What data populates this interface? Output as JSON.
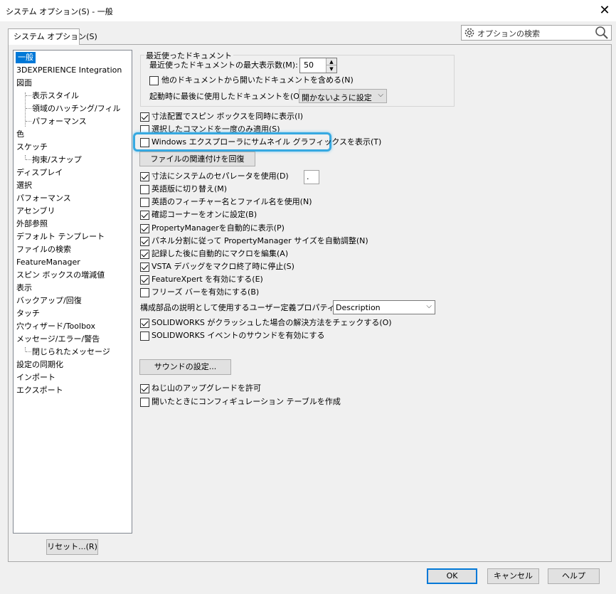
{
  "window": {
    "title": "システム オプション(S) - 一般",
    "close_glyph": "✕"
  },
  "tab": {
    "label": "システム オプション(S)"
  },
  "search": {
    "placeholder": "オプションの検索",
    "icon": "gear-icon",
    "search_icon": "magnifier-icon"
  },
  "tree": {
    "items": [
      {
        "label": "一般",
        "level": 0,
        "selected": true
      },
      {
        "label": "3DEXPERIENCE Integration",
        "level": 0
      },
      {
        "label": "図面",
        "level": 0
      },
      {
        "label": "表示スタイル",
        "level": 1
      },
      {
        "label": "領域のハッチング/フィル",
        "level": 1
      },
      {
        "label": "パフォーマンス",
        "level": 1
      },
      {
        "label": "色",
        "level": 0
      },
      {
        "label": "スケッチ",
        "level": 0
      },
      {
        "label": "拘束/スナップ",
        "level": 1
      },
      {
        "label": "ディスプレイ",
        "level": 0
      },
      {
        "label": "選択",
        "level": 0
      },
      {
        "label": "パフォーマンス",
        "level": 0
      },
      {
        "label": "アセンブリ",
        "level": 0
      },
      {
        "label": "外部参照",
        "level": 0
      },
      {
        "label": "デフォルト テンプレート",
        "level": 0
      },
      {
        "label": "ファイルの検索",
        "level": 0
      },
      {
        "label": "FeatureManager",
        "level": 0
      },
      {
        "label": "スピン ボックスの増減値",
        "level": 0
      },
      {
        "label": "表示",
        "level": 0
      },
      {
        "label": "バックアップ/回復",
        "level": 0
      },
      {
        "label": "タッチ",
        "level": 0
      },
      {
        "label": "穴ウィザード/Toolbox",
        "level": 0
      },
      {
        "label": "メッセージ/エラー/警告",
        "level": 0
      },
      {
        "label": "閉じられたメッセージ",
        "level": 1
      },
      {
        "label": "設定の同期化",
        "level": 0
      },
      {
        "label": "インポート",
        "level": 0
      },
      {
        "label": "エクスポート",
        "level": 0
      }
    ]
  },
  "recent": {
    "group_label": "最近使ったドキュメント",
    "max_label": "最近使ったドキュメントの最大表示数(M):",
    "max_value": "50",
    "include_label": "他のドキュメントから開いたドキュメントを含める(N)",
    "include_checked": false,
    "startup_label": "起動時に最後に使用したドキュメントを(O):",
    "startup_value": "開かないように設定"
  },
  "options": [
    {
      "label": "寸法配置でスピン ボックスを同時に表示(I)",
      "checked": true
    },
    {
      "label": "選択したコマンドを一度のみ適用(S)",
      "checked": false
    },
    {
      "label": "Windows エクスプローラにサムネイル グラフィックスを表示(T)",
      "checked": false
    },
    {
      "label": "寸法にシステムのセパレータを使用(D)",
      "checked": true
    },
    {
      "label": "英語版に切り替え(M)",
      "checked": false
    },
    {
      "label": "英語のフィーチャー名とファイル名を使用(N)",
      "checked": false
    },
    {
      "label": "確認コーナーをオンに設定(B)",
      "checked": true
    },
    {
      "label": "PropertyManagerを自動的に表示(P)",
      "checked": true
    },
    {
      "label": "パネル分割に従って PropertyManager サイズを自動調整(N)",
      "checked": true
    },
    {
      "label": "記録した後に自動的にマクロを編集(A)",
      "checked": true
    },
    {
      "label": "VSTA デバッグをマクロ終了時に停止(S)",
      "checked": true
    },
    {
      "label": "FeatureXpert を有効にする(E)",
      "checked": true
    },
    {
      "label": "フリーズ バーを有効にする(B)",
      "checked": false
    },
    {
      "label": "SOLIDWORKS がクラッシュした場合の解決方法をチェックする(O)",
      "checked": true
    },
    {
      "label": "SOLIDWORKS イベントのサウンドを有効にする",
      "checked": false
    },
    {
      "label": "ねじ山のアップグレードを許可",
      "checked": true
    },
    {
      "label": "開いたときにコンフィギュレーション テーブルを作成",
      "checked": false
    }
  ],
  "file_assoc_button": "ファイルの関連付けを回復",
  "separator_value": ".",
  "description": {
    "label": "構成部品の説明として使用するユーザー定義プロパティ:",
    "value": "Description"
  },
  "sound_button": "サウンドの設定...",
  "reset_button": "リセット...(R)",
  "footer": {
    "ok": "OK",
    "cancel": "キャンセル",
    "help": "ヘルプ"
  },
  "colors": {
    "selection": "#0078d7",
    "highlight": "#36a9e1"
  }
}
